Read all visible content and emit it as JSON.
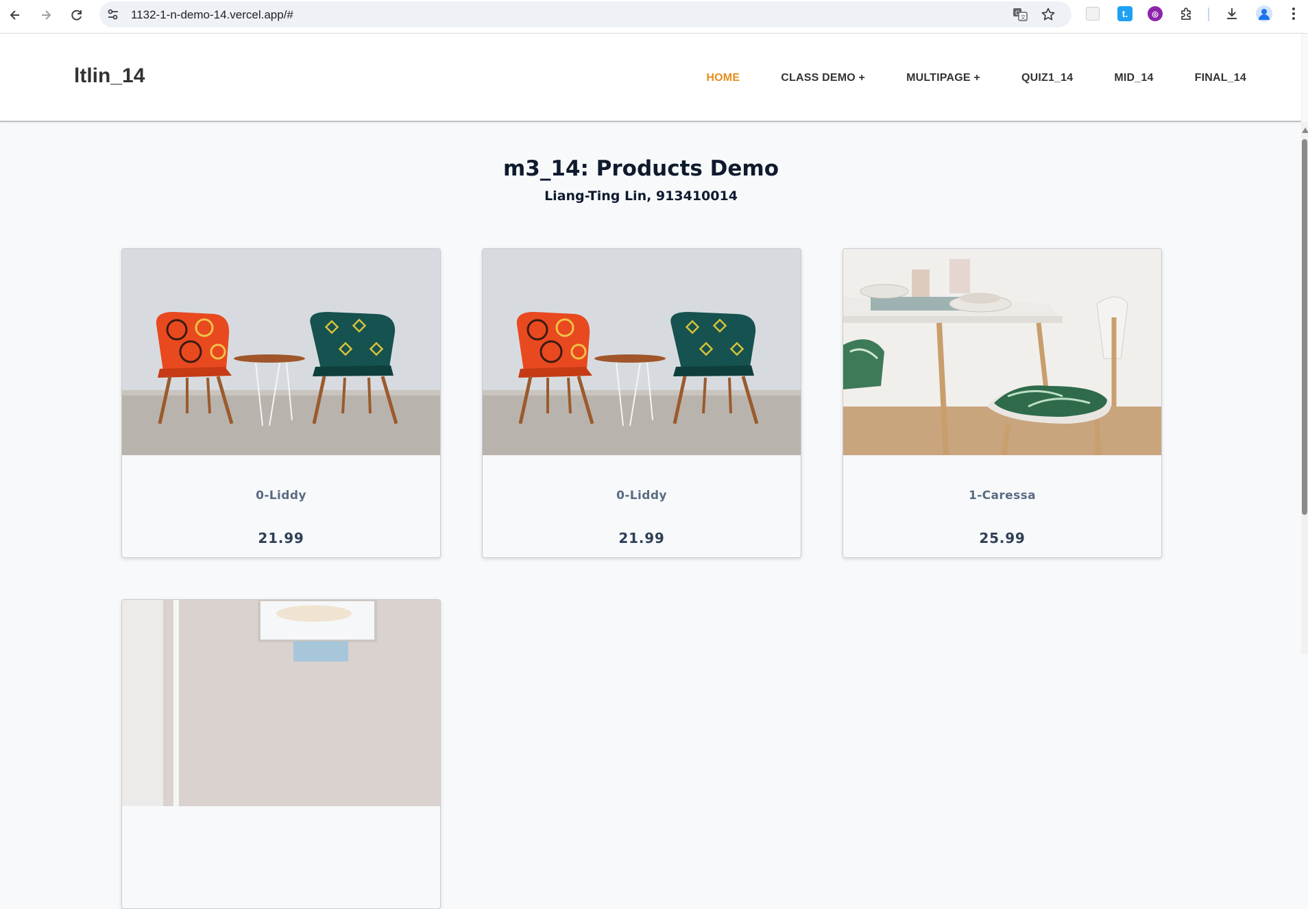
{
  "browser": {
    "url": "1132-1-n-demo-14.vercel.app/#"
  },
  "site": {
    "brand": "ltlin_14",
    "menu": [
      {
        "label": "HOME",
        "active": true
      },
      {
        "label": "CLASS DEMO +",
        "active": false
      },
      {
        "label": "MULTIPAGE +",
        "active": false
      },
      {
        "label": "QUIZ1_14",
        "active": false
      },
      {
        "label": "MID_14",
        "active": false
      },
      {
        "label": "FINAL_14",
        "active": false
      }
    ]
  },
  "page": {
    "title": "m3_14: Products Demo",
    "subtitle": "Liang-Ting Lin, 913410014"
  },
  "products": [
    {
      "name": "0-Liddy",
      "price": "21.99",
      "image": "two-patterned-chairs-photo"
    },
    {
      "name": "0-Liddy",
      "price": "21.99",
      "image": "two-patterned-chairs-photo"
    },
    {
      "name": "1-Caressa",
      "price": "25.99",
      "image": "dining-table-chair-photo"
    },
    {
      "name": "",
      "price": "",
      "image": "room-window-lamp-photo"
    }
  ],
  "colors": {
    "accent": "#e58e1a",
    "title": "#0f1a2e",
    "product_name": "#5a6b82",
    "price": "#2f3f56"
  }
}
